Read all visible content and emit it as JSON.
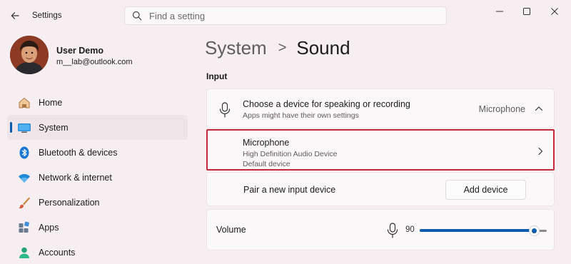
{
  "window": {
    "title": "Settings"
  },
  "search": {
    "placeholder": "Find a setting"
  },
  "profile": {
    "name": "User Demo",
    "email": "m__lab@outlook.com"
  },
  "sidebar": {
    "items": [
      {
        "label": "Home",
        "icon": "home-icon",
        "active": false
      },
      {
        "label": "System",
        "icon": "system-icon",
        "active": true
      },
      {
        "label": "Bluetooth & devices",
        "icon": "bluetooth-icon",
        "active": false
      },
      {
        "label": "Network & internet",
        "icon": "wifi-icon",
        "active": false
      },
      {
        "label": "Personalization",
        "icon": "brush-icon",
        "active": false
      },
      {
        "label": "Apps",
        "icon": "apps-icon",
        "active": false
      },
      {
        "label": "Accounts",
        "icon": "account-icon",
        "active": false
      }
    ]
  },
  "breadcrumb": {
    "parent": "System",
    "separator": ">",
    "current": "Sound"
  },
  "input_section": {
    "title": "Input",
    "choose_device": {
      "title": "Choose a device for speaking or recording",
      "subtitle": "Apps might have their own settings",
      "value": "Microphone"
    },
    "microphone": {
      "title": "Microphone",
      "line1": "High Definition Audio Device",
      "line2": "Default device"
    },
    "pair": {
      "label": "Pair a new input device",
      "button": "Add device"
    },
    "volume": {
      "label": "Volume",
      "value": "90",
      "level_percent": 90
    }
  },
  "colors": {
    "accent": "#0b5cad",
    "highlight_border": "#c5283a",
    "background": "#f6eef0"
  }
}
